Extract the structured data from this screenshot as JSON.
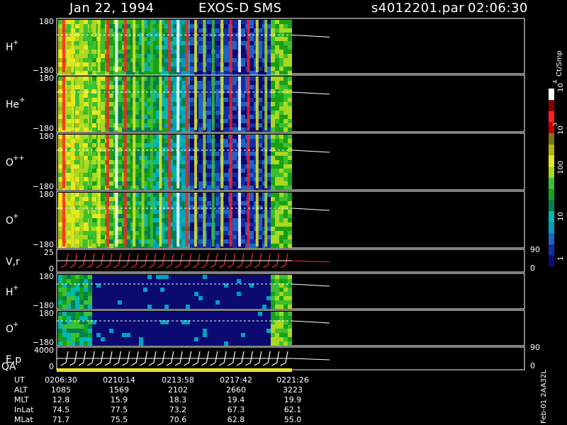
{
  "header": {
    "date": "Jan 22, 1994",
    "instrument": "EXOS-D SMS",
    "file": "s4012201.par",
    "time": "02:06:30"
  },
  "colorbar": {
    "unit_label": "Ct/Smp",
    "tick_labels": [
      "1",
      "10",
      "100",
      "10",
      "10"
    ],
    "exponents": [
      "3",
      "4"
    ],
    "colors": [
      "#0a0a70",
      "#102ea8",
      "#1a64c8",
      "#00a0c0",
      "#00b8b0",
      "#008050",
      "#18a018",
      "#3cc030",
      "#a8d820",
      "#e8e820",
      "#b4b414",
      "#7a7a10",
      "#c80000",
      "#ff2020",
      "#8a0000",
      "#ffffff"
    ]
  },
  "chart_data": {
    "type": "heatmap",
    "panels": [
      {
        "id": "h-plus",
        "name": "H",
        "superscript": "+",
        "ylim": [
          -180,
          180
        ],
        "ytick_labels": [
          "180",
          "−180"
        ]
      },
      {
        "id": "he-plus",
        "name": "He",
        "superscript": "+",
        "ylim": [
          -180,
          180
        ],
        "ytick_labels": [
          "180",
          "−180"
        ]
      },
      {
        "id": "o-plusplus",
        "name": "O",
        "superscript": "++",
        "ylim": [
          -180,
          180
        ],
        "ytick_labels": [
          "180",
          "−180"
        ]
      },
      {
        "id": "o-plus",
        "name": "O",
        "superscript": "+",
        "ylim": [
          -180,
          180
        ],
        "ytick_labels": [
          "180",
          "−180"
        ]
      },
      {
        "id": "v-r",
        "name": "V,r",
        "superscript": "",
        "ylim": [
          0,
          25
        ],
        "ytick_labels": [
          "25",
          "0"
        ],
        "right_ticks": [
          "90",
          "0"
        ]
      },
      {
        "id": "h-plus-2",
        "name": "H",
        "superscript": "+",
        "ylim": [
          -180,
          180
        ],
        "ytick_labels": [
          "180",
          "−180"
        ]
      },
      {
        "id": "o-plus-2",
        "name": "O",
        "superscript": "+",
        "ylim": [
          -180,
          180
        ],
        "ytick_labels": [
          "180",
          "−180"
        ]
      },
      {
        "id": "e-p",
        "name": "E,p",
        "superscript": "",
        "ylim": [
          0,
          4000
        ],
        "ytick_labels": [
          "4000",
          "0"
        ],
        "right_ticks": [
          "90",
          "0"
        ]
      }
    ],
    "qa_label": "QA",
    "side_label": "Feb-01 2AA32L",
    "x_axis": {
      "row_labels": [
        "UT",
        "ALT",
        "MLT",
        "InLat",
        "MLat"
      ],
      "columns": [
        [
          "0206:30",
          "1085",
          "12.8",
          "74.5",
          "71.7"
        ],
        [
          "0210:14",
          "1569",
          "15.9",
          "77.5",
          "75.5"
        ],
        [
          "0213:58",
          "2102",
          "18.3",
          "73.2",
          "70.6"
        ],
        [
          "0217:42",
          "2660",
          "19.4",
          "67.3",
          "62.8"
        ],
        [
          "0221:26",
          "3223",
          "19.9",
          "62.1",
          "55.0"
        ]
      ]
    }
  }
}
